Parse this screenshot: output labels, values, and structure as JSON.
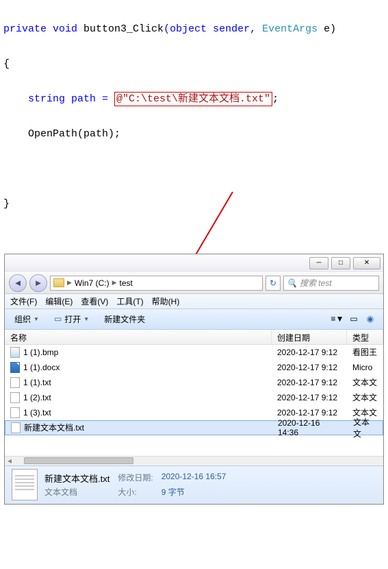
{
  "code": {
    "line1_pre": "private void ",
    "line1_name": "button3_Click",
    "line1_mid": "(object sender, ",
    "line1_type": "EventArgs",
    "line1_end": " e)",
    "brace_open": "{",
    "line3_pre": "    string path = ",
    "line3_str": "@\"C:\\test\\新建文本文档.txt\"",
    "line3_end": ";",
    "line4": "    OpenPath(path);",
    "brace_close": "}"
  },
  "titlebar": {},
  "nav": {
    "crumb1": "Win7 (C:)",
    "crumb2": "test",
    "search_placeholder": "搜索 test"
  },
  "menus": [
    "文件(F)",
    "编辑(E)",
    "查看(V)",
    "工具(T)",
    "帮助(H)"
  ],
  "toolbar": {
    "organize": "组织",
    "open": "打开",
    "newfolder": "新建文件夹"
  },
  "headers": {
    "name": "名称",
    "date": "创建日期",
    "type": "类型"
  },
  "files": [
    {
      "icon": "bmp",
      "name": "1 (1).bmp",
      "date": "2020-12-17 9:12",
      "type": "看图王"
    },
    {
      "icon": "docx",
      "name": "1 (1).docx",
      "date": "2020-12-17 9:12",
      "type": "Micro"
    },
    {
      "icon": "txt",
      "name": "1 (1).txt",
      "date": "2020-12-17 9:12",
      "type": "文本文"
    },
    {
      "icon": "txt",
      "name": "1 (2).txt",
      "date": "2020-12-17 9:12",
      "type": "文本文"
    },
    {
      "icon": "txt",
      "name": "1 (3).txt",
      "date": "2020-12-17 9:12",
      "type": "文本文"
    },
    {
      "icon": "txt",
      "name": "新建文本文档.txt",
      "date": "2020-12-16 14:36",
      "type": "文本文",
      "sel": true
    }
  ],
  "details": {
    "filename": "新建文本文档.txt",
    "filetype": "文本文档",
    "mod_label": "修改日期:",
    "mod_value": "2020-12-16 16:57",
    "size_label": "大小:",
    "size_value": "9 字节"
  }
}
